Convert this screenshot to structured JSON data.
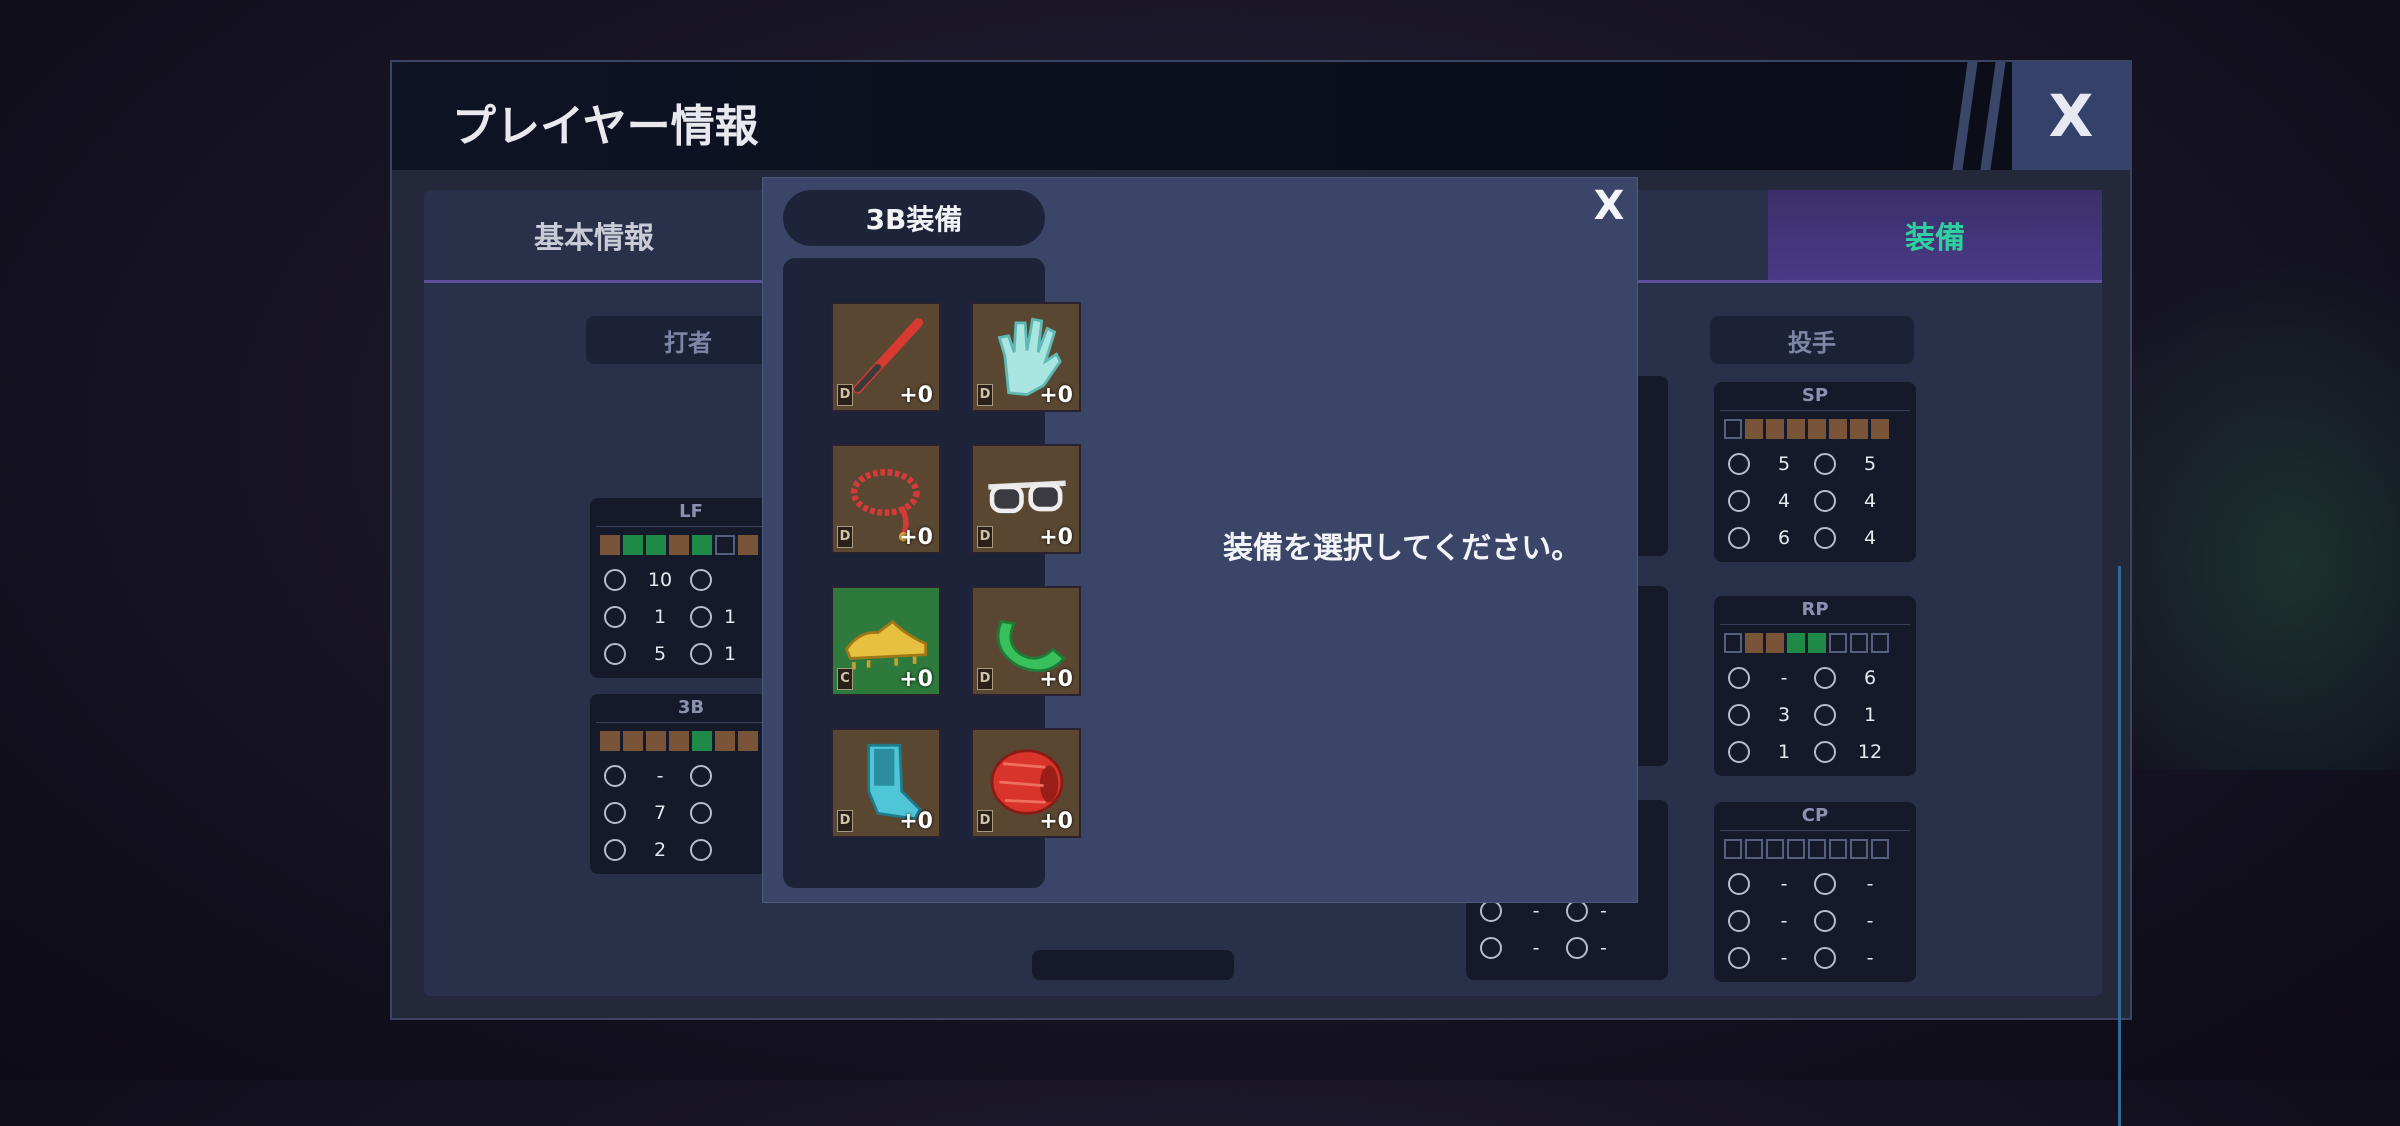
{
  "header": {
    "title": "プレイヤー情報",
    "close_label": "X"
  },
  "tabs": {
    "basic": "基本情報",
    "equipment": "装備"
  },
  "sections": {
    "batter": "打者",
    "pitcher": "投手"
  },
  "batter_cards": [
    {
      "pos": "LF",
      "bars": [
        "br",
        "gr",
        "gr",
        "br",
        "gr",
        "em",
        "br"
      ],
      "stats": [
        [
          "10",
          ""
        ],
        [
          "1",
          "1"
        ],
        [
          "5",
          "1"
        ]
      ]
    },
    {
      "pos": "3B",
      "bars": [
        "br",
        "br",
        "br",
        "br",
        "gr",
        "br",
        "br"
      ],
      "stats": [
        [
          "-",
          ""
        ],
        [
          "7",
          ""
        ],
        [
          "2",
          ""
        ]
      ]
    }
  ],
  "pitcher_cards": [
    {
      "pos": "SP",
      "bars": [
        "em",
        "br",
        "br",
        "br",
        "br",
        "br",
        "br",
        "br"
      ],
      "stats": [
        [
          "5",
          "5"
        ],
        [
          "4",
          "4"
        ],
        [
          "6",
          "4"
        ]
      ]
    },
    {
      "pos": "RP",
      "bars": [
        "em",
        "br",
        "br",
        "gr",
        "gr",
        "em",
        "em",
        "em"
      ],
      "stats": [
        [
          "-",
          "6"
        ],
        [
          "3",
          "1"
        ],
        [
          "1",
          "12"
        ]
      ]
    },
    {
      "pos": "CP",
      "bars": [
        "em",
        "em",
        "em",
        "em",
        "em",
        "em",
        "em",
        "em"
      ],
      "stats": [
        [
          "-",
          "-"
        ],
        [
          "-",
          "-"
        ],
        [
          "-",
          "-"
        ]
      ]
    }
  ],
  "partial_card": {
    "stats": [
      [
        "-",
        "-"
      ],
      [
        "-",
        "-"
      ]
    ]
  },
  "dialog": {
    "title": "3B装備",
    "close_label": "X",
    "message": "装備を選択してください。",
    "slots": [
      {
        "item": "bat",
        "rank": "D",
        "level": "+0"
      },
      {
        "item": "glove",
        "rank": "D",
        "level": "+0"
      },
      {
        "item": "necklace",
        "rank": "D",
        "level": "+0"
      },
      {
        "item": "sunglasses",
        "rank": "D",
        "level": "+0"
      },
      {
        "item": "spikes",
        "rank": "C",
        "level": "+0"
      },
      {
        "item": "wristband",
        "rank": "D",
        "level": "+0"
      },
      {
        "item": "leg-guard",
        "rank": "D",
        "level": "+0"
      },
      {
        "item": "sleeve",
        "rank": "D",
        "level": "+0"
      }
    ]
  }
}
